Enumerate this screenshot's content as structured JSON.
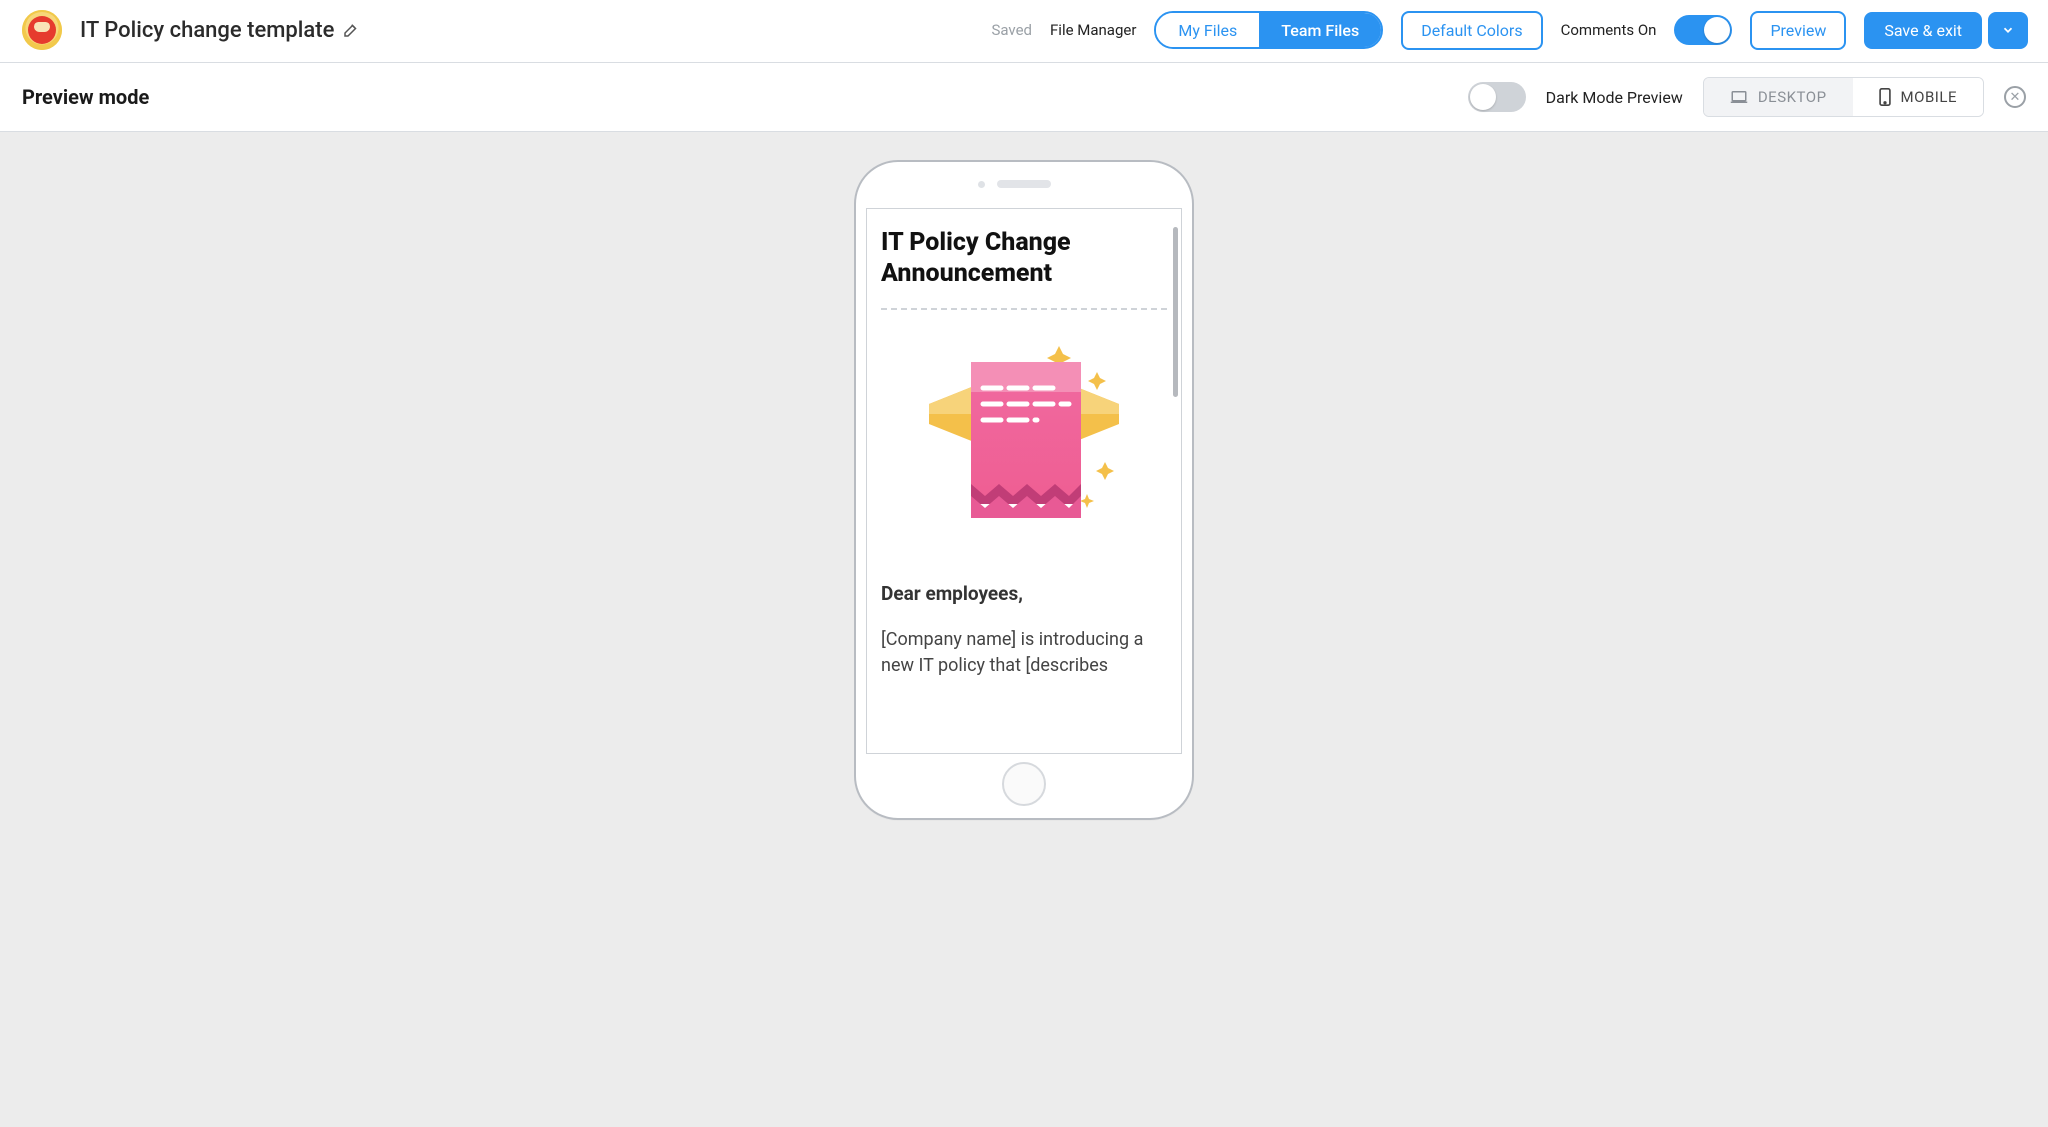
{
  "header": {
    "doc_title": "IT Policy change template",
    "saved_label": "Saved",
    "file_manager_label": "File Manager",
    "files_tabs": {
      "my": "My Files",
      "team": "Team Files",
      "active": "team"
    },
    "default_colors_label": "Default Colors",
    "comments_label": "Comments On",
    "preview_label": "Preview",
    "save_exit_label": "Save & exit"
  },
  "preview_bar": {
    "title": "Preview mode",
    "dark_mode_label": "Dark Mode Preview",
    "device": {
      "desktop": "DESKTOP",
      "mobile": "MOBILE",
      "active": "mobile"
    }
  },
  "email": {
    "title": "IT Policy Change Announcement",
    "greeting": "Dear employees,",
    "body_line": "[Company name] is introducing a new IT policy that [describes"
  },
  "colors": {
    "accent": "#2b93f1"
  }
}
